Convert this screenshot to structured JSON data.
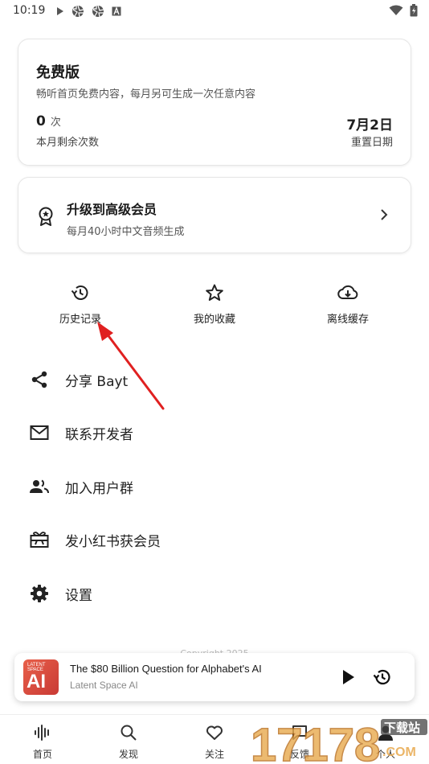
{
  "status_bar": {
    "time": "10:19",
    "notification_icons": [
      "play-icon",
      "aperture-icon",
      "aperture-icon",
      "a-badge-icon"
    ],
    "right_icons": [
      "wifi-icon",
      "battery-icon"
    ]
  },
  "plan": {
    "title": "免费版",
    "description": "畅听首页免费内容，每月另可生成一次任意内容",
    "count": "0",
    "count_unit": "次",
    "count_label": "本月剩余次数",
    "reset_date": "7月2日",
    "reset_label": "重置日期"
  },
  "upgrade": {
    "title": "升级到高级会员",
    "description": "每月40小时中文音频生成",
    "icon": "award-icon"
  },
  "quick_actions": [
    {
      "label": "历史记录",
      "icon": "history-icon"
    },
    {
      "label": "我的收藏",
      "icon": "star-icon"
    },
    {
      "label": "离线缓存",
      "icon": "cloud-download-icon"
    }
  ],
  "menu": [
    {
      "label": "分享 Bayt",
      "icon": "share-icon"
    },
    {
      "label": "联系开发者",
      "icon": "mail-icon"
    },
    {
      "label": "加入用户群",
      "icon": "group-icon"
    },
    {
      "label": "发小红书获会员",
      "icon": "gift-icon"
    },
    {
      "label": "设置",
      "icon": "gear-icon"
    }
  ],
  "copyright": "Copyright 2025",
  "player": {
    "art_text_top": "LATENT SPACE",
    "art_text_main": "AI",
    "title": "The $80 Billion Question for Alphabet's AI",
    "subtitle": "Latent Space AI"
  },
  "bottom_nav": [
    {
      "label": "首页",
      "icon": "waveform-icon"
    },
    {
      "label": "发现",
      "icon": "search-icon"
    },
    {
      "label": "关注",
      "icon": "heart-icon"
    },
    {
      "label": "反馈",
      "icon": "chat-icon"
    },
    {
      "label": "个人",
      "icon": "person-icon"
    }
  ],
  "watermark": {
    "text": "17178",
    "sub": "下载站",
    "domain": ".COM"
  },
  "colors": {
    "arrow": "#e02020",
    "text": "#1f1f1f",
    "muted": "#555555",
    "accent_art": "#d9473c"
  }
}
